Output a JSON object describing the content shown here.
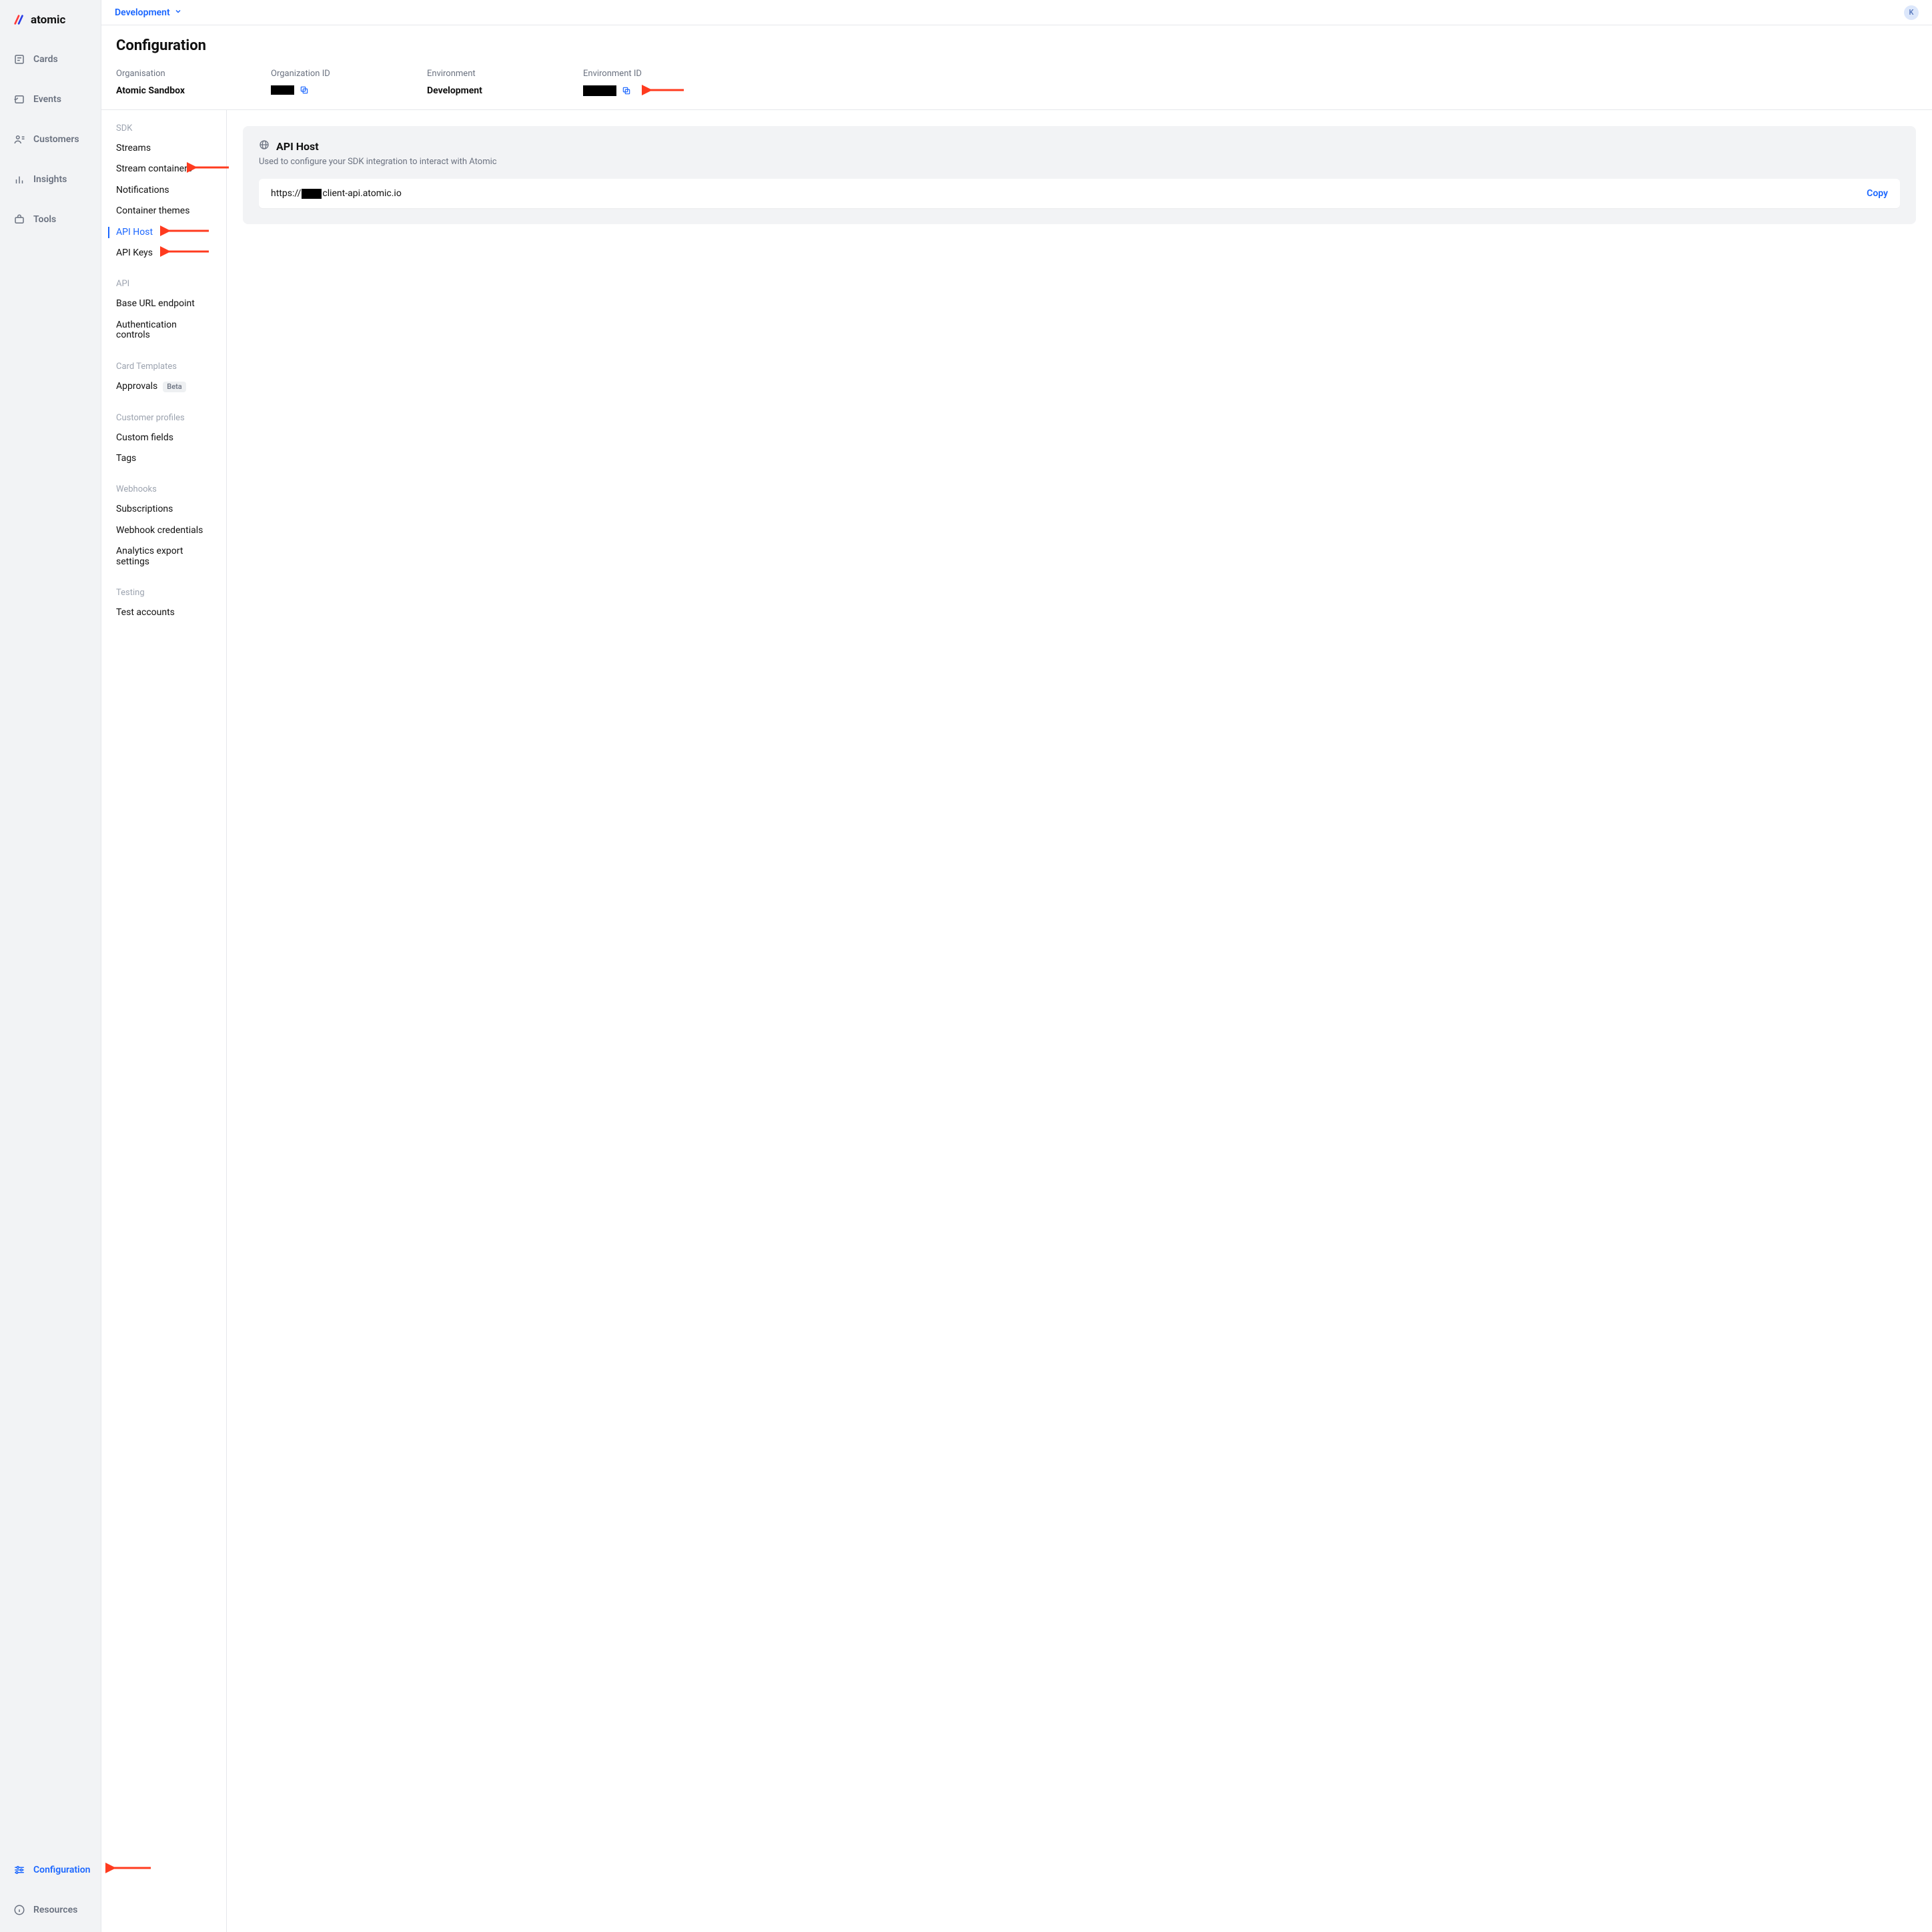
{
  "brand": "atomic",
  "sidebar": {
    "top": [
      {
        "label": "Cards"
      },
      {
        "label": "Events"
      },
      {
        "label": "Customers"
      },
      {
        "label": "Insights"
      },
      {
        "label": "Tools"
      }
    ],
    "bottom": [
      {
        "label": "Configuration"
      },
      {
        "label": "Resources"
      }
    ]
  },
  "topbar": {
    "env": "Development",
    "avatar": "K"
  },
  "page": {
    "title": "Configuration",
    "org_label": "Organisation",
    "org_value": "Atomic Sandbox",
    "orgid_label": "Organization ID",
    "env_label": "Environment",
    "env_value": "Development",
    "envid_label": "Environment ID"
  },
  "subnav": {
    "sdk_title": "SDK",
    "sdk_items": [
      {
        "label": "Streams"
      },
      {
        "label": "Stream containers"
      },
      {
        "label": "Notifications"
      },
      {
        "label": "Container themes"
      },
      {
        "label": "API Host"
      },
      {
        "label": "API Keys"
      }
    ],
    "api_title": "API",
    "api_items": [
      {
        "label": "Base URL endpoint"
      },
      {
        "label": "Authentication controls"
      }
    ],
    "ct_title": "Card Templates",
    "ct_items": [
      {
        "label": "Approvals",
        "badge": "Beta"
      }
    ],
    "cp_title": "Customer profiles",
    "cp_items": [
      {
        "label": "Custom fields"
      },
      {
        "label": "Tags"
      }
    ],
    "wh_title": "Webhooks",
    "wh_items": [
      {
        "label": "Subscriptions"
      },
      {
        "label": "Webhook credentials"
      },
      {
        "label": "Analytics export settings"
      }
    ],
    "t_title": "Testing",
    "t_items": [
      {
        "label": "Test accounts"
      }
    ]
  },
  "content": {
    "title": "API Host",
    "subtitle": "Used to configure your SDK integration to interact with Atomic",
    "url_pre": "https://",
    "url_post": "client-api.atomic.io",
    "copy": "Copy"
  }
}
